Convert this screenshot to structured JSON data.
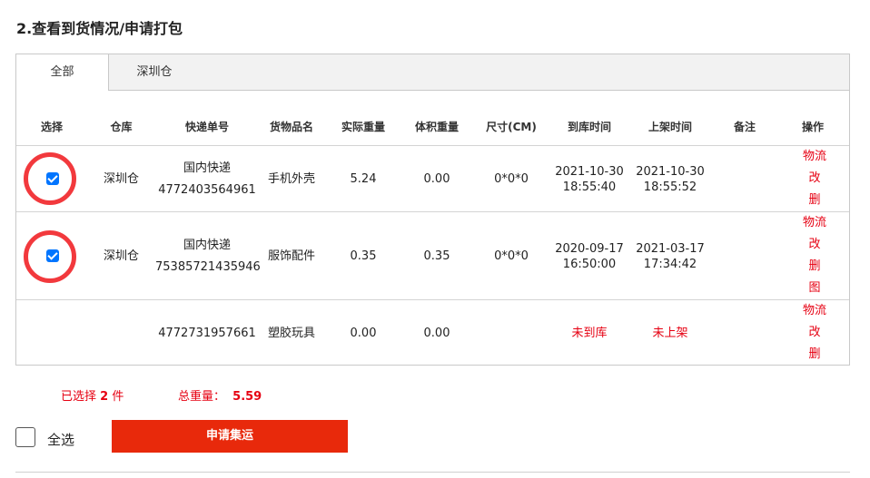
{
  "section_title": "2.查看到货情况/申请打包",
  "tabs": [
    "全部",
    "深圳仓"
  ],
  "headers": [
    "选择",
    "仓库",
    "快递单号",
    "货物品名",
    "实际重量",
    "体积重量",
    "尺寸(CM)",
    "到库时间",
    "上架时间",
    "备注",
    "操作"
  ],
  "rows": [
    {
      "checked": true,
      "warehouse": "深圳仓",
      "courier": "国内快递",
      "tracking": "4772403564961",
      "goods": "手机外壳",
      "actual_weight": "5.24",
      "volume_weight": "0.00",
      "size": "0*0*0",
      "arrival_date": "2021-10-30",
      "arrival_time": "18:55:40",
      "shelf_date": "2021-10-30",
      "shelf_time": "18:55:52",
      "remark": "",
      "actions": [
        "物流",
        "改",
        "删"
      ]
    },
    {
      "checked": true,
      "warehouse": "深圳仓",
      "courier": "国内快递",
      "tracking": "75385721435946",
      "goods": "服饰配件",
      "actual_weight": "0.35",
      "volume_weight": "0.35",
      "size": "0*0*0",
      "arrival_date": "2020-09-17",
      "arrival_time": "16:50:00",
      "shelf_date": "2021-03-17",
      "shelf_time": "17:34:42",
      "remark": "",
      "actions": [
        "物流",
        "改",
        "删",
        "图"
      ]
    },
    {
      "checked": false,
      "warehouse": "",
      "courier": "",
      "tracking": "4772731957661",
      "goods": "塑胶玩具",
      "actual_weight": "0.00",
      "volume_weight": "0.00",
      "size": "",
      "arrival_status": "未到库",
      "shelf_status": "未上架",
      "remark": "",
      "actions": [
        "物流",
        "改",
        "删"
      ]
    }
  ],
  "summary": {
    "selected_label": "已选择",
    "selected_count": "2",
    "selected_unit": "件",
    "total_weight_label": "总重量：",
    "total_weight": "5.59"
  },
  "select_all_label": "全选",
  "submit_label": "申请集运",
  "colors": {
    "accent_red": "#e60012",
    "button_red": "#e8290b",
    "checkbox_blue": "#0075ff",
    "highlight_ring": "#f2393d"
  }
}
